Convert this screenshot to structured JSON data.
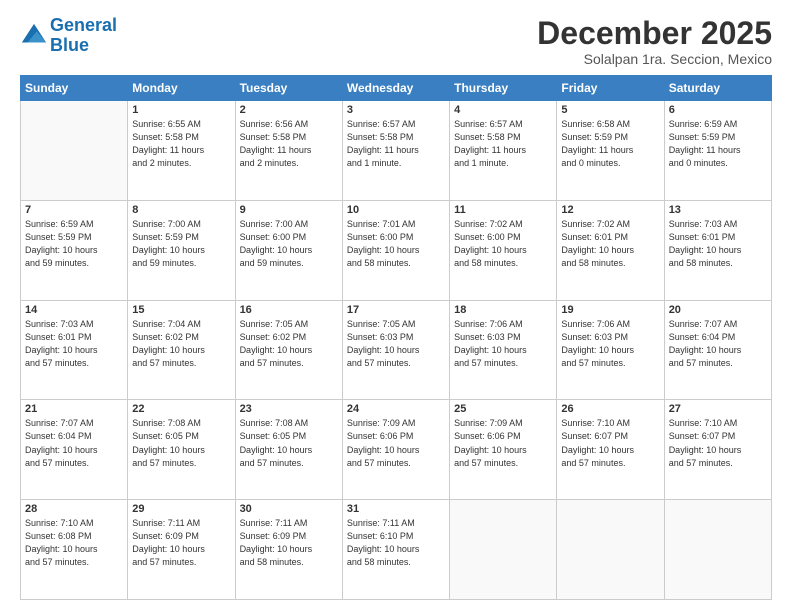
{
  "header": {
    "logo_line1": "General",
    "logo_line2": "Blue",
    "month": "December 2025",
    "location": "Solalpan 1ra. Seccion, Mexico"
  },
  "weekdays": [
    "Sunday",
    "Monday",
    "Tuesday",
    "Wednesday",
    "Thursday",
    "Friday",
    "Saturday"
  ],
  "weeks": [
    [
      {
        "day": "",
        "info": ""
      },
      {
        "day": "1",
        "info": "Sunrise: 6:55 AM\nSunset: 5:58 PM\nDaylight: 11 hours\nand 2 minutes."
      },
      {
        "day": "2",
        "info": "Sunrise: 6:56 AM\nSunset: 5:58 PM\nDaylight: 11 hours\nand 2 minutes."
      },
      {
        "day": "3",
        "info": "Sunrise: 6:57 AM\nSunset: 5:58 PM\nDaylight: 11 hours\nand 1 minute."
      },
      {
        "day": "4",
        "info": "Sunrise: 6:57 AM\nSunset: 5:58 PM\nDaylight: 11 hours\nand 1 minute."
      },
      {
        "day": "5",
        "info": "Sunrise: 6:58 AM\nSunset: 5:59 PM\nDaylight: 11 hours\nand 0 minutes."
      },
      {
        "day": "6",
        "info": "Sunrise: 6:59 AM\nSunset: 5:59 PM\nDaylight: 11 hours\nand 0 minutes."
      }
    ],
    [
      {
        "day": "7",
        "info": "Sunrise: 6:59 AM\nSunset: 5:59 PM\nDaylight: 10 hours\nand 59 minutes."
      },
      {
        "day": "8",
        "info": "Sunrise: 7:00 AM\nSunset: 5:59 PM\nDaylight: 10 hours\nand 59 minutes."
      },
      {
        "day": "9",
        "info": "Sunrise: 7:00 AM\nSunset: 6:00 PM\nDaylight: 10 hours\nand 59 minutes."
      },
      {
        "day": "10",
        "info": "Sunrise: 7:01 AM\nSunset: 6:00 PM\nDaylight: 10 hours\nand 58 minutes."
      },
      {
        "day": "11",
        "info": "Sunrise: 7:02 AM\nSunset: 6:00 PM\nDaylight: 10 hours\nand 58 minutes."
      },
      {
        "day": "12",
        "info": "Sunrise: 7:02 AM\nSunset: 6:01 PM\nDaylight: 10 hours\nand 58 minutes."
      },
      {
        "day": "13",
        "info": "Sunrise: 7:03 AM\nSunset: 6:01 PM\nDaylight: 10 hours\nand 58 minutes."
      }
    ],
    [
      {
        "day": "14",
        "info": "Sunrise: 7:03 AM\nSunset: 6:01 PM\nDaylight: 10 hours\nand 57 minutes."
      },
      {
        "day": "15",
        "info": "Sunrise: 7:04 AM\nSunset: 6:02 PM\nDaylight: 10 hours\nand 57 minutes."
      },
      {
        "day": "16",
        "info": "Sunrise: 7:05 AM\nSunset: 6:02 PM\nDaylight: 10 hours\nand 57 minutes."
      },
      {
        "day": "17",
        "info": "Sunrise: 7:05 AM\nSunset: 6:03 PM\nDaylight: 10 hours\nand 57 minutes."
      },
      {
        "day": "18",
        "info": "Sunrise: 7:06 AM\nSunset: 6:03 PM\nDaylight: 10 hours\nand 57 minutes."
      },
      {
        "day": "19",
        "info": "Sunrise: 7:06 AM\nSunset: 6:03 PM\nDaylight: 10 hours\nand 57 minutes."
      },
      {
        "day": "20",
        "info": "Sunrise: 7:07 AM\nSunset: 6:04 PM\nDaylight: 10 hours\nand 57 minutes."
      }
    ],
    [
      {
        "day": "21",
        "info": "Sunrise: 7:07 AM\nSunset: 6:04 PM\nDaylight: 10 hours\nand 57 minutes."
      },
      {
        "day": "22",
        "info": "Sunrise: 7:08 AM\nSunset: 6:05 PM\nDaylight: 10 hours\nand 57 minutes."
      },
      {
        "day": "23",
        "info": "Sunrise: 7:08 AM\nSunset: 6:05 PM\nDaylight: 10 hours\nand 57 minutes."
      },
      {
        "day": "24",
        "info": "Sunrise: 7:09 AM\nSunset: 6:06 PM\nDaylight: 10 hours\nand 57 minutes."
      },
      {
        "day": "25",
        "info": "Sunrise: 7:09 AM\nSunset: 6:06 PM\nDaylight: 10 hours\nand 57 minutes."
      },
      {
        "day": "26",
        "info": "Sunrise: 7:10 AM\nSunset: 6:07 PM\nDaylight: 10 hours\nand 57 minutes."
      },
      {
        "day": "27",
        "info": "Sunrise: 7:10 AM\nSunset: 6:07 PM\nDaylight: 10 hours\nand 57 minutes."
      }
    ],
    [
      {
        "day": "28",
        "info": "Sunrise: 7:10 AM\nSunset: 6:08 PM\nDaylight: 10 hours\nand 57 minutes."
      },
      {
        "day": "29",
        "info": "Sunrise: 7:11 AM\nSunset: 6:09 PM\nDaylight: 10 hours\nand 57 minutes."
      },
      {
        "day": "30",
        "info": "Sunrise: 7:11 AM\nSunset: 6:09 PM\nDaylight: 10 hours\nand 58 minutes."
      },
      {
        "day": "31",
        "info": "Sunrise: 7:11 AM\nSunset: 6:10 PM\nDaylight: 10 hours\nand 58 minutes."
      },
      {
        "day": "",
        "info": ""
      },
      {
        "day": "",
        "info": ""
      },
      {
        "day": "",
        "info": ""
      }
    ]
  ]
}
